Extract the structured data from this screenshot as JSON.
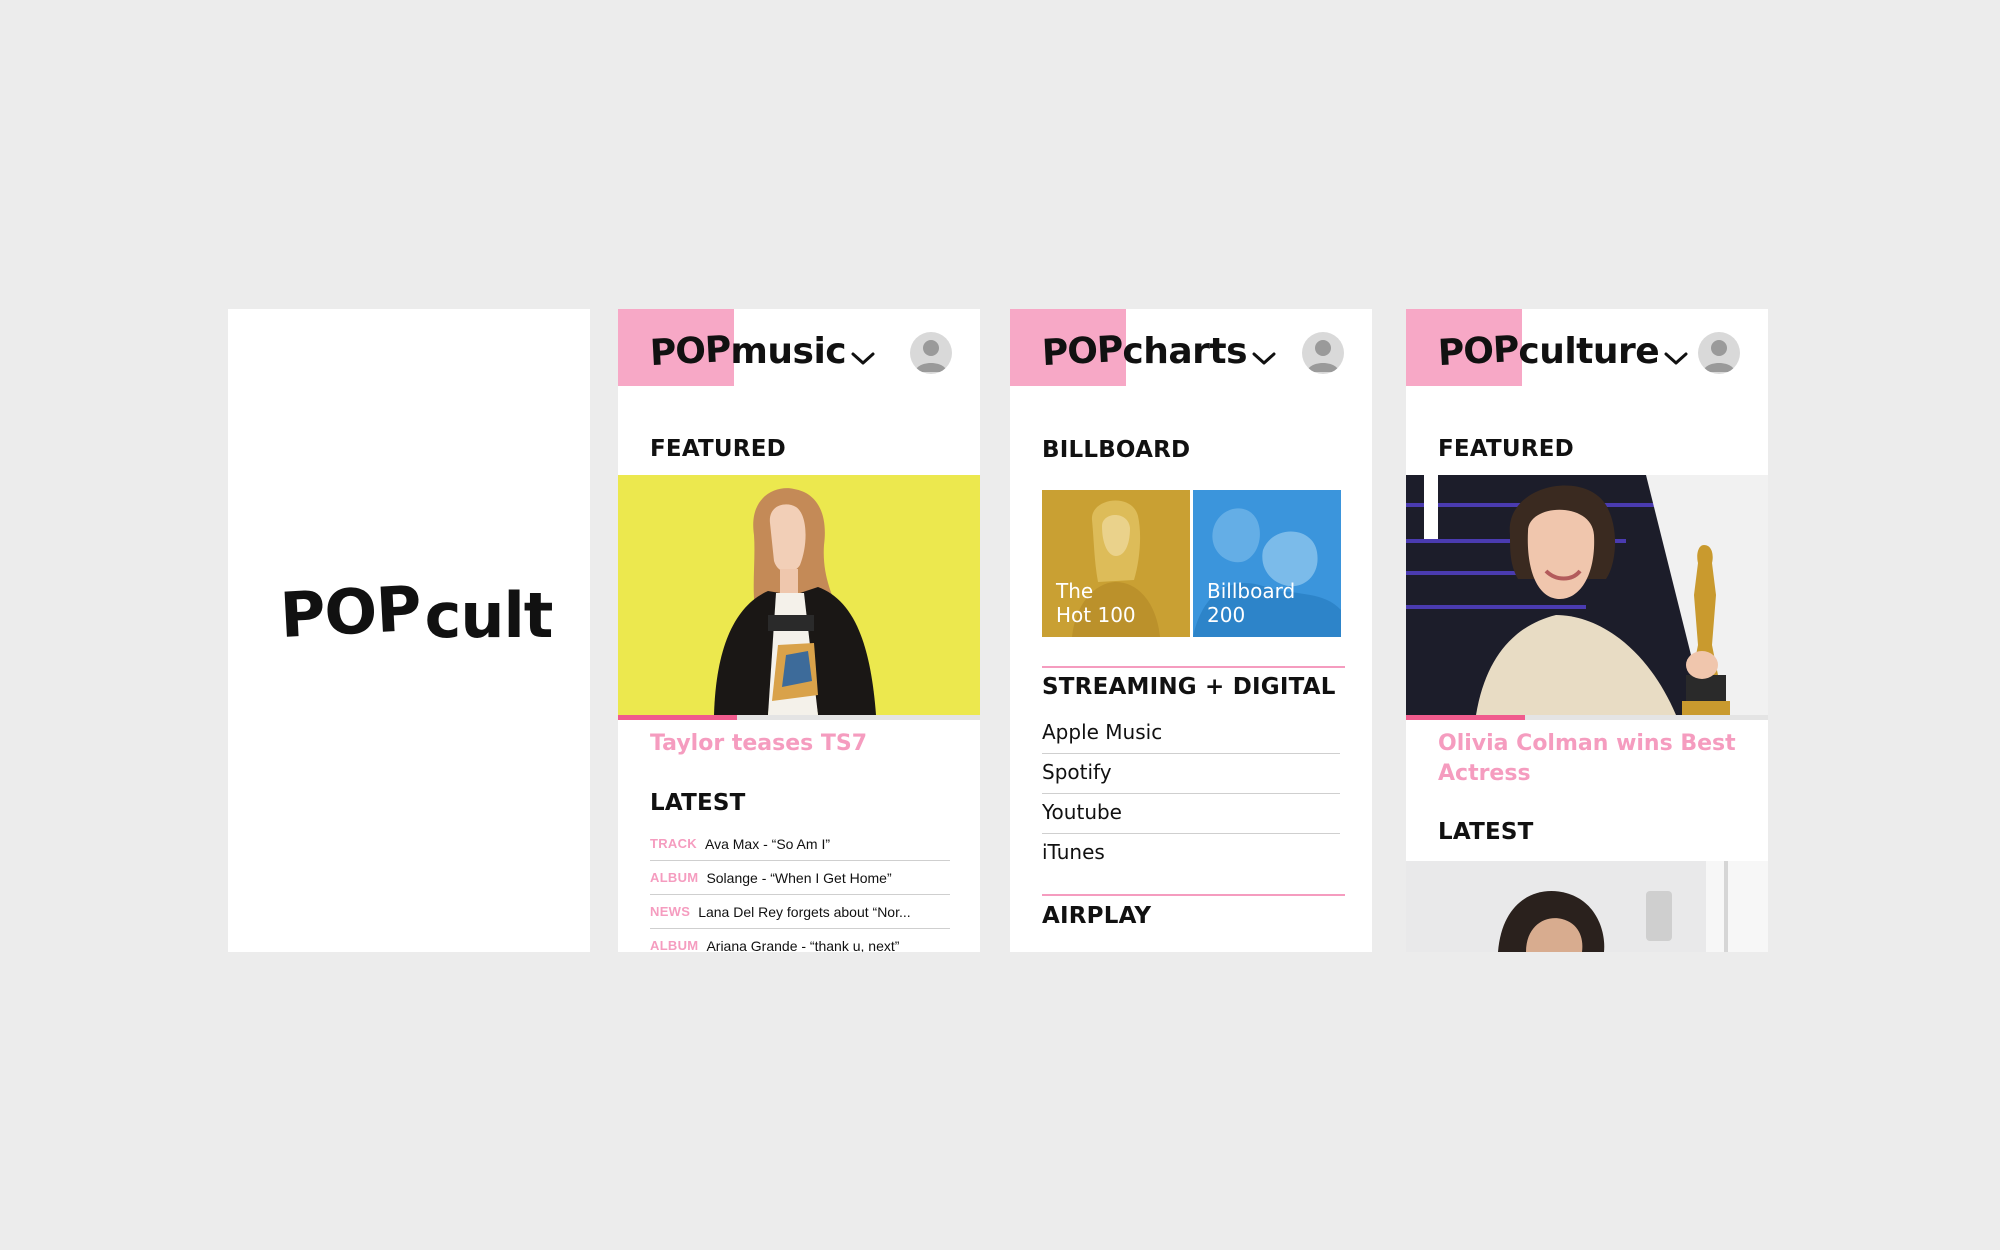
{
  "splash": {
    "logo_pop": "POP",
    "logo_suffix": "cult"
  },
  "music": {
    "logo_pop": "POP",
    "logo_suffix": "music",
    "featured_heading": "FEATURED",
    "featured_caption": "Taylor teases TS7",
    "featured_progress": 0.33,
    "latest_heading": "LATEST",
    "latest": [
      {
        "tag": "TRACK",
        "title": "Ava Max - “So Am I”"
      },
      {
        "tag": "ALBUM",
        "title": "Solange - “When I Get Home”"
      },
      {
        "tag": "NEWS",
        "title": "Lana Del Rey forgets about “Nor..."
      },
      {
        "tag": "ALBUM",
        "title": "Ariana Grande - “thank u, next”"
      }
    ]
  },
  "charts": {
    "logo_pop": "POP",
    "logo_suffix": "charts",
    "billboard_heading": "BILLBOARD",
    "tiles": [
      {
        "label": "The\nHot 100",
        "color": "#c9a033"
      },
      {
        "label": "Billboard\n200",
        "color": "#3b95dc"
      }
    ],
    "streaming_heading": "STREAMING + DIGITAL",
    "services": [
      "Apple Music",
      "Spotify",
      "Youtube",
      "iTunes"
    ],
    "airplay_heading": "AIRPLAY"
  },
  "culture": {
    "logo_pop": "POP",
    "logo_suffix": "culture",
    "featured_heading": "FEATURED",
    "featured_caption": "Olivia Colman wins Best Actress",
    "featured_progress": 0.33,
    "latest_heading": "LATEST"
  },
  "colors": {
    "accent_pink": "#f7a8c6",
    "caption_pink": "#f59cbf",
    "progress_pink": "#f05b8d",
    "background": "#ececec"
  },
  "icons": {
    "chevron": "chevron-down-icon",
    "avatar": "user-avatar-icon"
  }
}
